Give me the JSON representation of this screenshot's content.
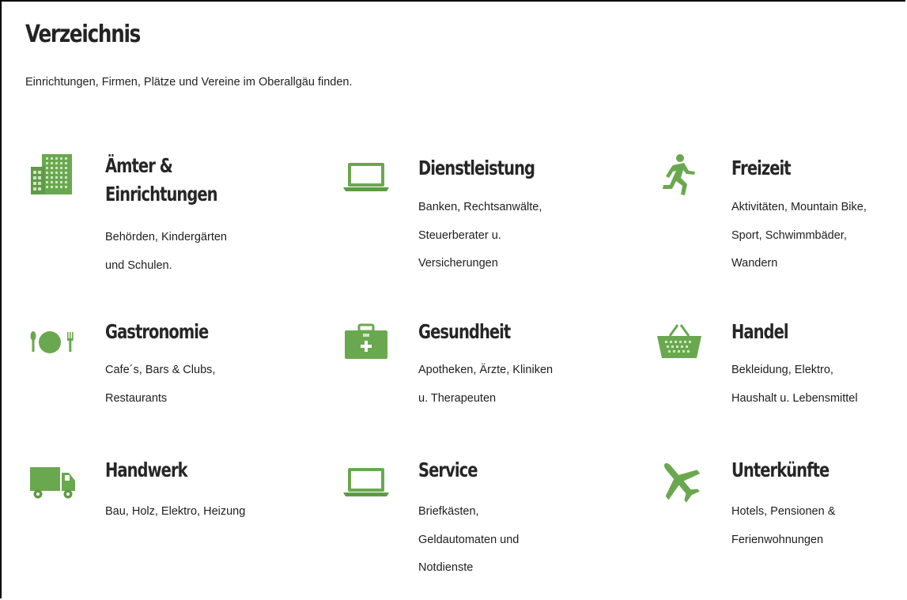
{
  "page": {
    "title": "Verzeichnis",
    "intro": "Einrichtungen, Firmen, Plätze und Vereine im Oberallgäu finden."
  },
  "colors": {
    "icon_green": "#6aa84f",
    "icon_green_dark": "#4f8a3a"
  },
  "categories": [
    {
      "key": "aemter",
      "icon": "building-icon",
      "title_line1": "Ämter &",
      "title_line2": "Einrichtungen",
      "desc_line1": "Behörden, Kindergärten",
      "desc_line2": "und Schulen.",
      "desc_line3": ""
    },
    {
      "key": "dienstleistung",
      "icon": "laptop-icon",
      "title_line1": "Dienstleistung",
      "title_line2": "",
      "desc_line1": "Banken, Rechtsanwälte,",
      "desc_line2": "Steuerberater u.",
      "desc_line3": "Versicherungen"
    },
    {
      "key": "freizeit",
      "icon": "running-man-icon",
      "title_line1": "Freizeit",
      "title_line2": "",
      "desc_line1": "Aktivitäten, Mountain Bike,",
      "desc_line2": "Sport, Schwimmbäder,",
      "desc_line3": "Wandern"
    },
    {
      "key": "gastronomie",
      "icon": "plate-cutlery-icon",
      "title_line1": "Gastronomie",
      "title_line2": "",
      "desc_line1": "Cafe´s, Bars & Clubs,",
      "desc_line2": "Restaurants",
      "desc_line3": ""
    },
    {
      "key": "gesundheit",
      "icon": "first-aid-kit-icon",
      "title_line1": "Gesundheit",
      "title_line2": "",
      "desc_line1": "Apotheken, Ärzte, Kliniken",
      "desc_line2": "u. Therapeuten",
      "desc_line3": ""
    },
    {
      "key": "handel",
      "icon": "shopping-basket-icon",
      "title_line1": "Handel",
      "title_line2": "",
      "desc_line1": "Bekleidung, Elektro,",
      "desc_line2": "Haushalt u. Lebensmittel",
      "desc_line3": ""
    },
    {
      "key": "handwerk",
      "icon": "truck-icon",
      "title_line1": "Handwerk",
      "title_line2": "",
      "desc_line1": "Bau, Holz, Elektro, Heizung",
      "desc_line2": "",
      "desc_line3": ""
    },
    {
      "key": "service",
      "icon": "laptop-icon",
      "title_line1": "Service",
      "title_line2": "",
      "desc_line1": "Briefkästen,",
      "desc_line2": "Geldautomaten und",
      "desc_line3": "Notdienste"
    },
    {
      "key": "unterkuenfte",
      "icon": "airplane-icon",
      "title_line1": "Unterkünfte",
      "title_line2": "",
      "desc_line1": "Hotels, Pensionen &",
      "desc_line2": "Ferienwohnungen",
      "desc_line3": ""
    }
  ]
}
